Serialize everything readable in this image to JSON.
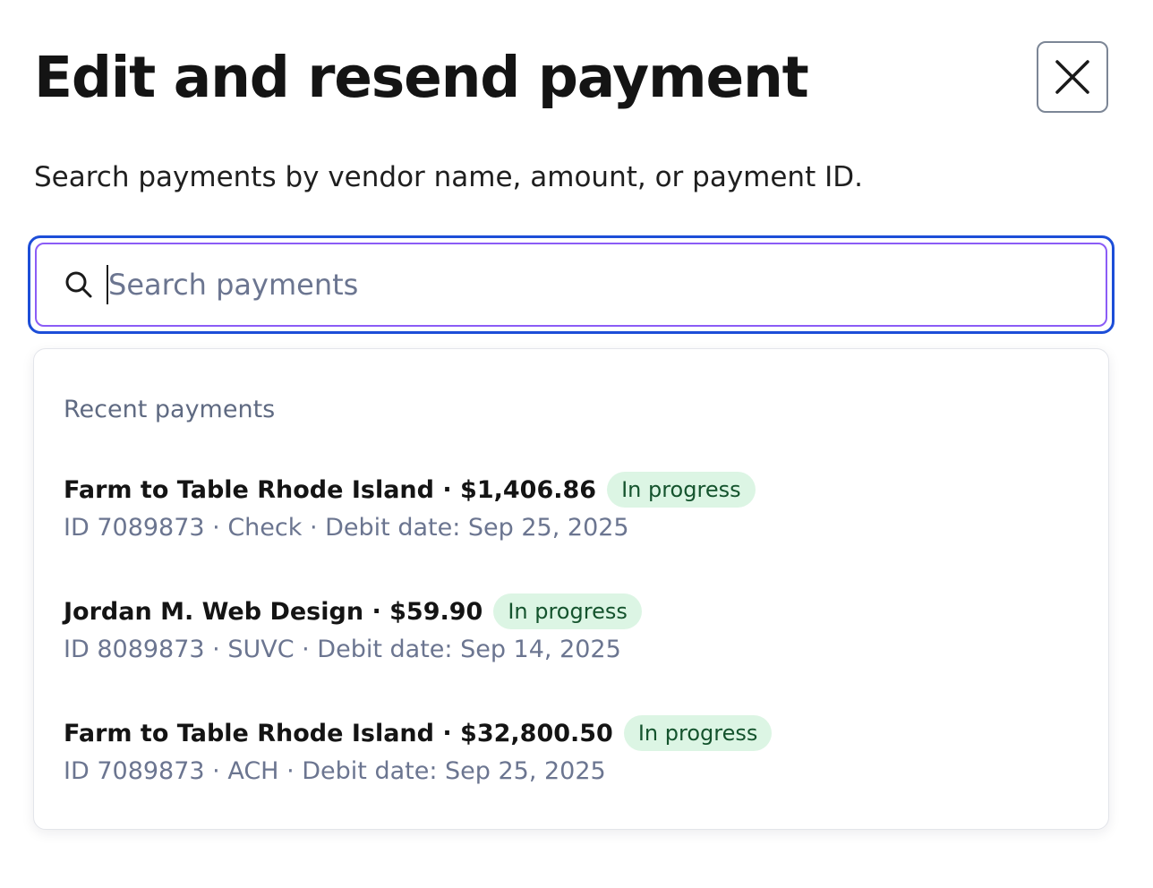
{
  "modal": {
    "title": "Edit and resend payment",
    "subtitle": "Search payments by vendor name, amount, or payment ID.",
    "close_icon": "close-icon"
  },
  "search": {
    "placeholder": "Search payments",
    "value": "",
    "icon": "search-icon"
  },
  "dropdown": {
    "section_label": "Recent payments",
    "payments": [
      {
        "title": "Farm to Table Rhode Island · $1,406.86",
        "status": "In progress",
        "details": "ID 7089873 · Check · Debit date: Sep 25, 2025"
      },
      {
        "title": "Jordan M. Web Design · $59.90",
        "status": "In progress",
        "details": "ID 8089873 · SUVC · Debit date: Sep 14, 2025"
      },
      {
        "title": "Farm to Table Rhode Island · $32,800.50",
        "status": "In progress",
        "details": "ID 7089873 · ACH · Debit date: Sep 25, 2025"
      }
    ]
  },
  "colors": {
    "focus_ring": "#1d4ed8",
    "inner_ring": "#8b5cf6",
    "badge_bg": "#dcf5e4",
    "badge_text": "#14532d",
    "muted_text": "#6b7590"
  }
}
